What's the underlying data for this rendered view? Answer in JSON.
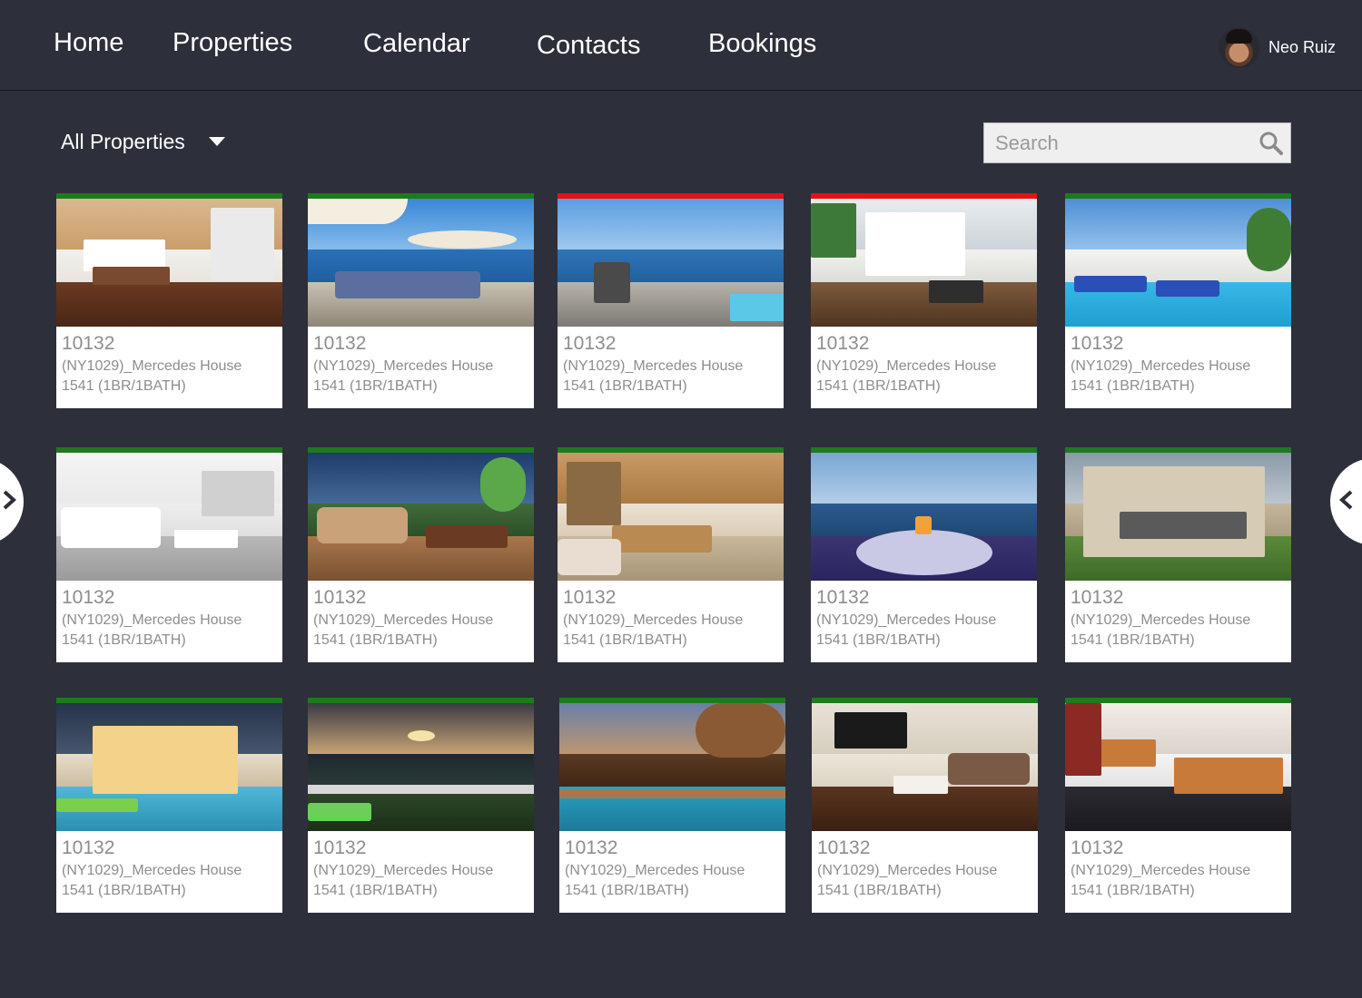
{
  "nav": {
    "home": "Home",
    "properties": "Properties",
    "calendar": "Calendar",
    "contacts": "Contacts",
    "bookings": "Bookings"
  },
  "user": {
    "name": "Neo Ruiz"
  },
  "filter": {
    "selected": "All Properties"
  },
  "search": {
    "placeholder": "Search"
  },
  "colors": {
    "available": "#1e7a1e",
    "booked": "#e41212",
    "background": "#2d2f3a"
  },
  "properties": [
    {
      "id": "10132",
      "name": "(NY1029)_Mercedes House",
      "unit": "1541 (1BR/1BATH)",
      "status": "available",
      "photo": "bedroom"
    },
    {
      "id": "10132",
      "name": "(NY1029)_Mercedes House",
      "unit": "1541 (1BR/1BATH)",
      "status": "available",
      "photo": "terrace-umbrella"
    },
    {
      "id": "10132",
      "name": "(NY1029)_Mercedes House",
      "unit": "1541 (1BR/1BATH)",
      "status": "booked",
      "photo": "ocean-deck"
    },
    {
      "id": "10132",
      "name": "(NY1029)_Mercedes House",
      "unit": "1541 (1BR/1BATH)",
      "status": "booked",
      "photo": "villa-deck"
    },
    {
      "id": "10132",
      "name": "(NY1029)_Mercedes House",
      "unit": "1541 (1BR/1BATH)",
      "status": "available",
      "photo": "pool-villa"
    },
    {
      "id": "10132",
      "name": "(NY1029)_Mercedes House",
      "unit": "1541 (1BR/1BATH)",
      "status": "available",
      "photo": "living-room-white"
    },
    {
      "id": "10132",
      "name": "(NY1029)_Mercedes House",
      "unit": "1541 (1BR/1BATH)",
      "status": "available",
      "photo": "jacuzzi-terrace"
    },
    {
      "id": "10132",
      "name": "(NY1029)_Mercedes House",
      "unit": "1541 (1BR/1BATH)",
      "status": "available",
      "photo": "lounge-wood"
    },
    {
      "id": "10132",
      "name": "(NY1029)_Mercedes House",
      "unit": "1541 (1BR/1BATH)",
      "status": "available",
      "photo": "sea-table"
    },
    {
      "id": "10132",
      "name": "(NY1029)_Mercedes House",
      "unit": "1541 (1BR/1BATH)",
      "status": "available",
      "photo": "modern-house"
    },
    {
      "id": "10132",
      "name": "(NY1029)_Mercedes House",
      "unit": "1541 (1BR/1BATH)",
      "status": "available",
      "photo": "night-villa"
    },
    {
      "id": "10132",
      "name": "(NY1029)_Mercedes House",
      "unit": "1541 (1BR/1BATH)",
      "status": "available",
      "photo": "sunset-coast"
    },
    {
      "id": "10132",
      "name": "(NY1029)_Mercedes House",
      "unit": "1541 (1BR/1BATH)",
      "status": "available",
      "photo": "evening-pool"
    },
    {
      "id": "10132",
      "name": "(NY1029)_Mercedes House",
      "unit": "1541 (1BR/1BATH)",
      "status": "available",
      "photo": "tv-lounge"
    },
    {
      "id": "10132",
      "name": "(NY1029)_Mercedes House",
      "unit": "1541 (1BR/1BATH)",
      "status": "available",
      "photo": "patio-dining"
    }
  ]
}
